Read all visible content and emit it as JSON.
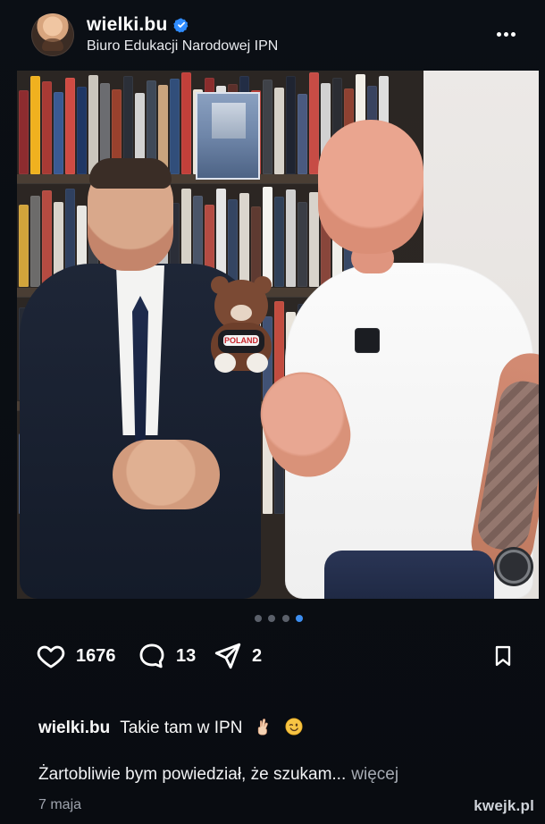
{
  "header": {
    "username": "wielki.bu",
    "subtitle": "Biuro Edukacji Narodowej IPN"
  },
  "media": {
    "bear_label": "POLAND"
  },
  "carousel": {
    "count": 4,
    "active_index": 4
  },
  "actions": {
    "likes": "1676",
    "comments": "13",
    "shares": "2"
  },
  "caption": {
    "username": "wielki.bu",
    "text": "Takie tam w IPN",
    "extended": "Żartobliwie bym powiedział, że szukam...",
    "more_label": "więcej"
  },
  "date": "7 maja",
  "watermark": "kwejk.pl",
  "colors": {
    "background": "#0a0d12",
    "accent": "#3d8ef0",
    "muted": "#9ea3ad"
  },
  "icons": {
    "more": "more-icon",
    "verified": "verified-icon",
    "like": "heart-icon",
    "comment": "comment-icon",
    "share": "share-icon",
    "save": "bookmark-icon",
    "hand": "victory-hand-icon",
    "wink": "winking-face-icon"
  }
}
